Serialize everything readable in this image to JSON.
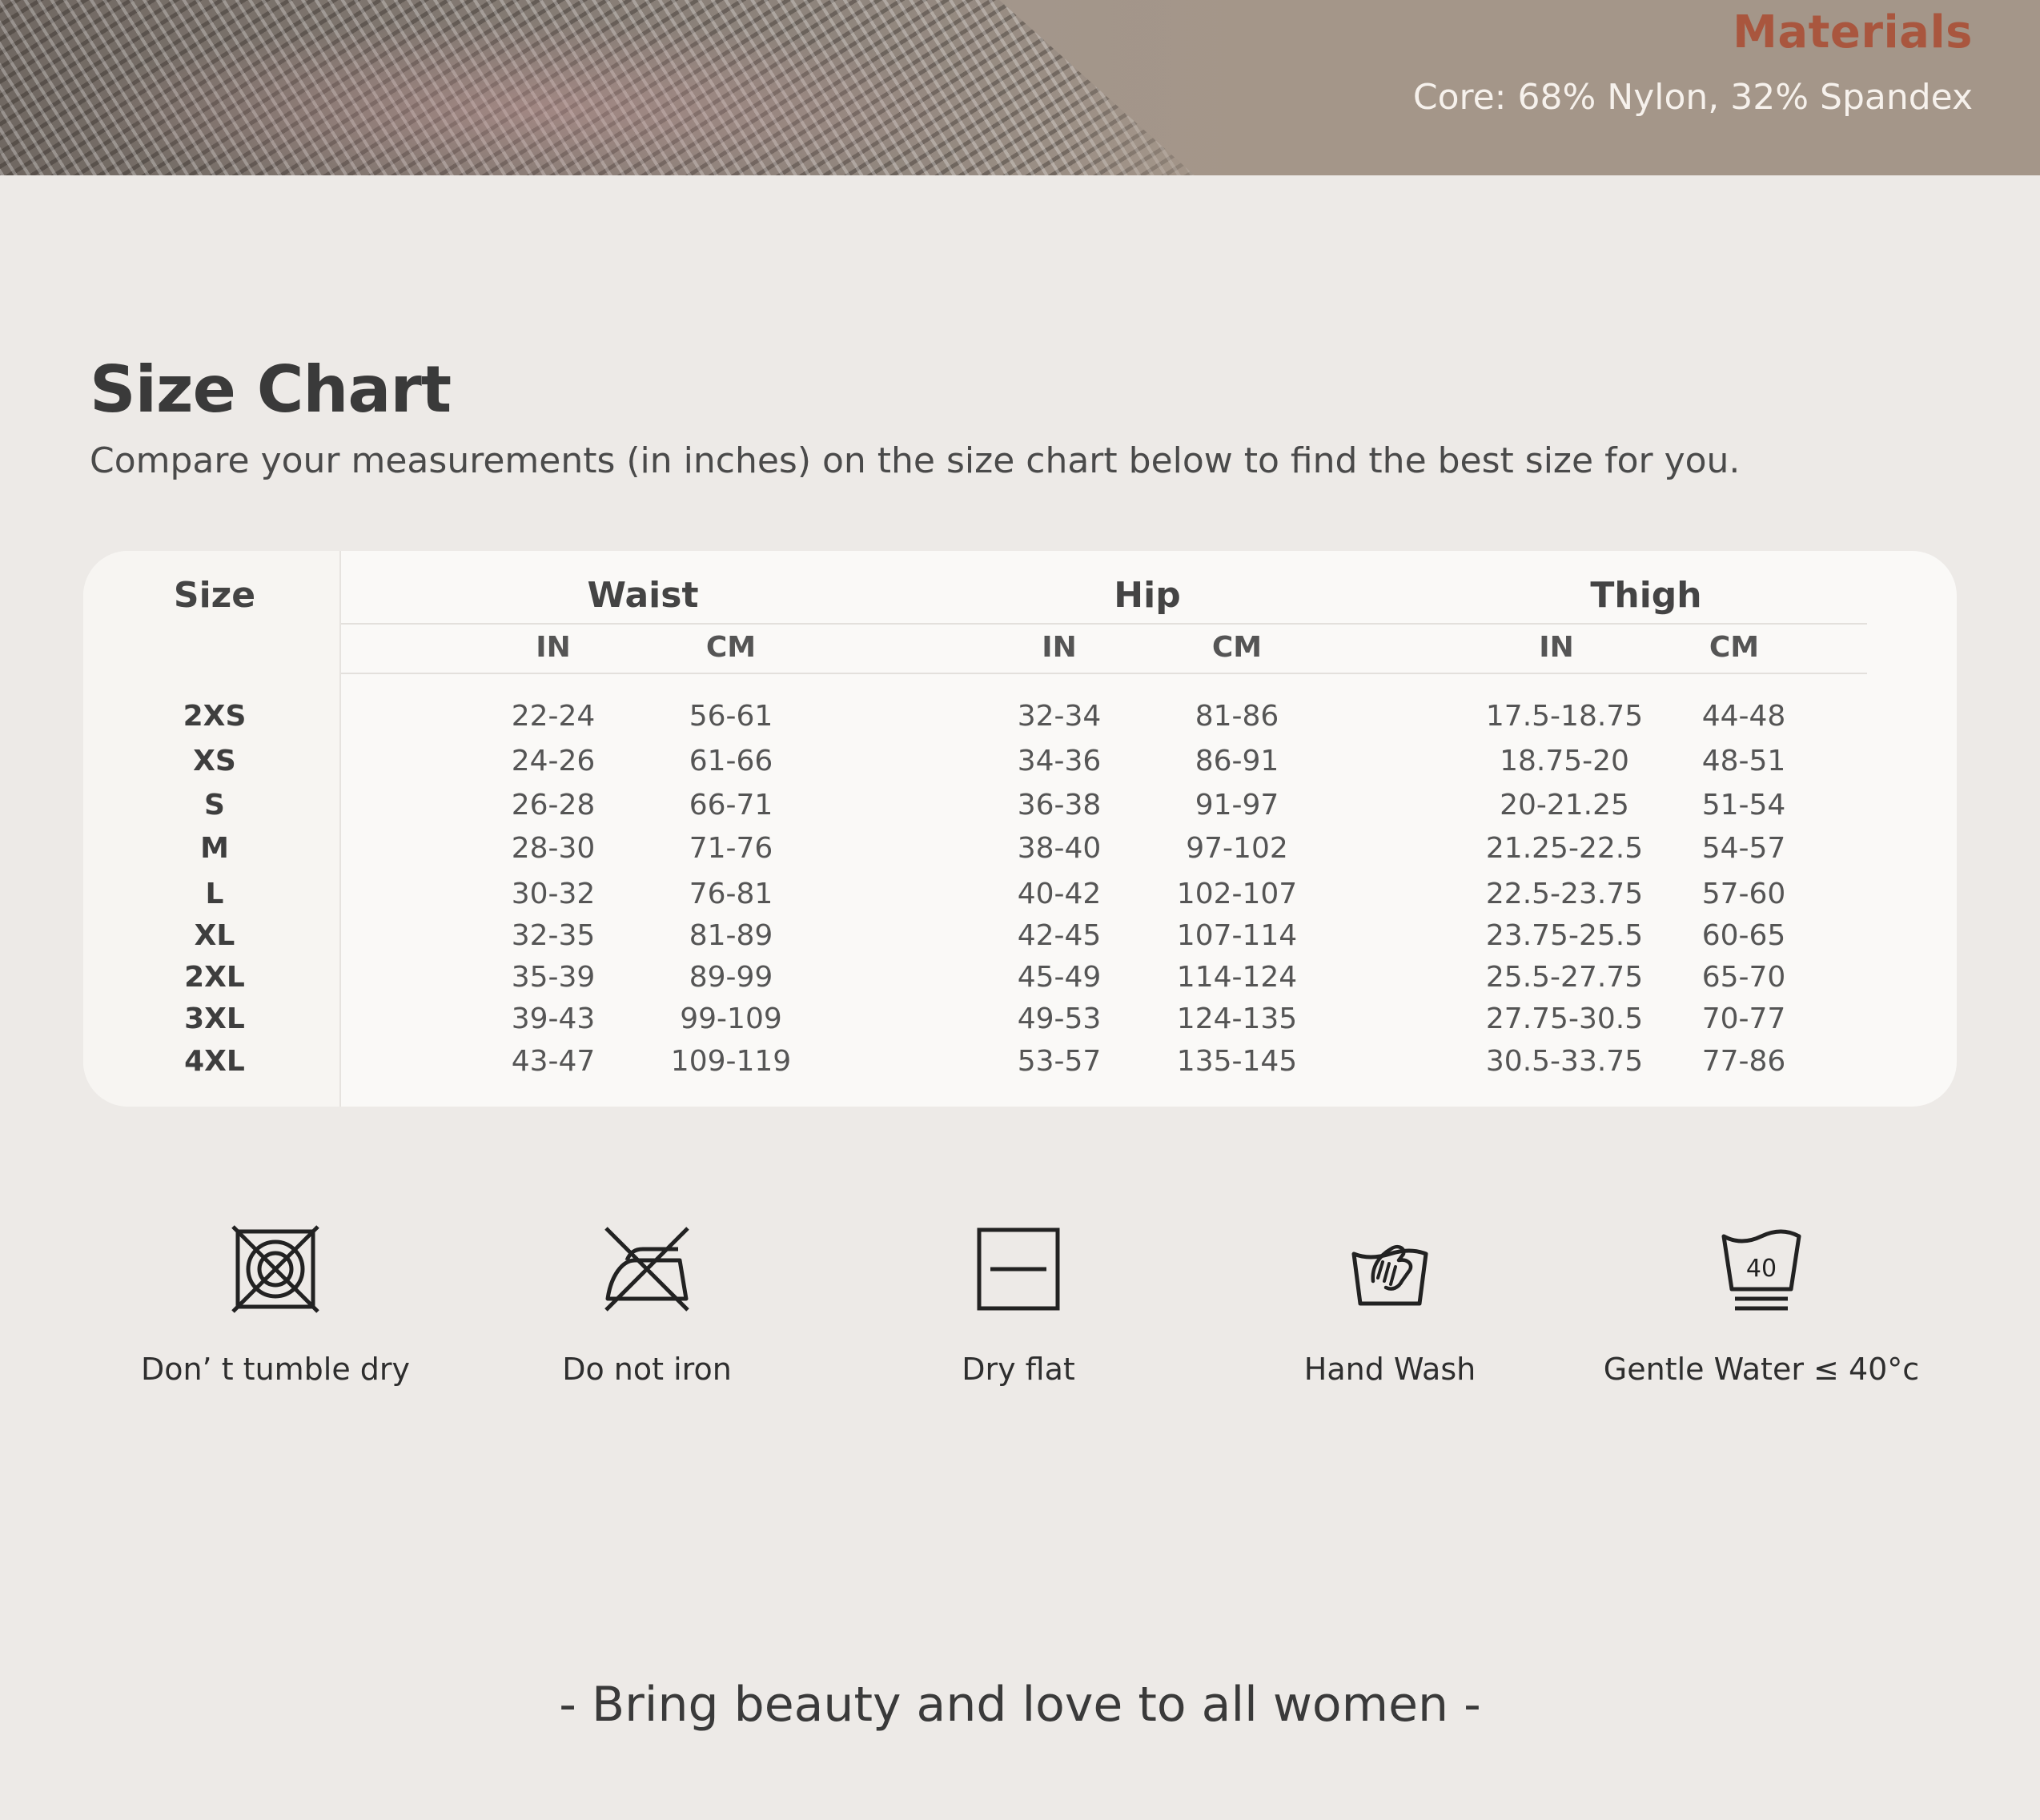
{
  "banner": {
    "materials_title": "Materials",
    "materials_core": "Core: 68% Nylon, 32% Spandex"
  },
  "heading": {
    "title": "Size Chart",
    "subtitle": "Compare your measurements (in inches) on the size chart below to find the best size for you."
  },
  "table": {
    "size_header": "Size",
    "groups": [
      "Waist",
      "Hip",
      "Thigh"
    ],
    "units": [
      "IN",
      "CM",
      "IN",
      "CM",
      "IN",
      "CM"
    ],
    "rows": [
      {
        "size": "2XS",
        "values": [
          "22-24",
          "56-61",
          "32-34",
          "81-86",
          "17.5-18.75",
          "44-48"
        ]
      },
      {
        "size": "XS",
        "values": [
          "24-26",
          "61-66",
          "34-36",
          "86-91",
          "18.75-20",
          "48-51"
        ]
      },
      {
        "size": "S",
        "values": [
          "26-28",
          "66-71",
          "36-38",
          "91-97",
          "20-21.25",
          "51-54"
        ]
      },
      {
        "size": "M",
        "values": [
          "28-30",
          "71-76",
          "38-40",
          "97-102",
          "21.25-22.5",
          "54-57"
        ]
      },
      {
        "size": "L",
        "values": [
          "30-32",
          "76-81",
          "40-42",
          "102-107",
          "22.5-23.75",
          "57-60"
        ]
      },
      {
        "size": "XL",
        "values": [
          "32-35",
          "81-89",
          "42-45",
          "107-114",
          "23.75-25.5",
          "60-65"
        ]
      },
      {
        "size": "2XL",
        "values": [
          "35-39",
          "89-99",
          "45-49",
          "114-124",
          "25.5-27.75",
          "65-70"
        ]
      },
      {
        "size": "3XL",
        "values": [
          "39-43",
          "99-109",
          "49-53",
          "124-135",
          "27.75-30.5",
          "70-77"
        ]
      },
      {
        "size": "4XL",
        "values": [
          "43-47",
          "109-119",
          "53-57",
          "135-145",
          "30.5-33.75",
          "77-86"
        ]
      }
    ]
  },
  "care": {
    "items": [
      {
        "icon": "no-tumble-dry-icon",
        "label": "Don’ t tumble dry"
      },
      {
        "icon": "do-not-iron-icon",
        "label": "Do not iron"
      },
      {
        "icon": "dry-flat-icon",
        "label": "Dry flat"
      },
      {
        "icon": "hand-wash-icon",
        "label": "Hand Wash"
      },
      {
        "icon": "wash-40-icon",
        "label": "Gentle Water ≤ 40°c",
        "temp": "40"
      }
    ]
  },
  "footer": {
    "tagline": "- Bring beauty and love to all women -"
  },
  "colors": {
    "page_bg": "#edeae7",
    "card_bg": "#faf9f7",
    "accent": "#a9563e",
    "text": "#3c3c3c"
  }
}
